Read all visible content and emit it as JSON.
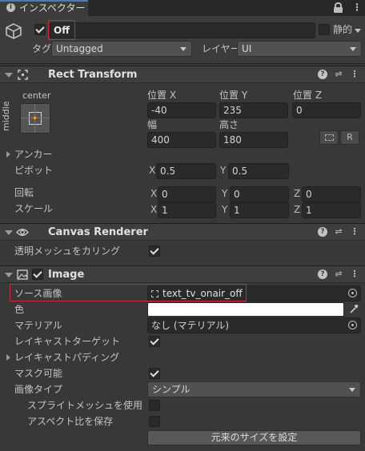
{
  "tab": {
    "title": "インスペクター"
  },
  "object": {
    "name": "Off",
    "static_label": "静的",
    "tag_label": "タグ",
    "tag_value": "Untagged",
    "layer_label": "レイヤー",
    "layer_value": "UI"
  },
  "rect_transform": {
    "title": "Rect Transform",
    "anchor_h": "center",
    "anchor_v": "middle",
    "pos_x_label": "位置 X",
    "pos_y_label": "位置 Y",
    "pos_z_label": "位置 Z",
    "pos_x": "-40",
    "pos_y": "235",
    "pos_z": "0",
    "width_label": "幅",
    "height_label": "高さ",
    "width": "400",
    "height": "180",
    "raw_button": "R",
    "anchors_label": "アンカー",
    "pivot_label": "ピボット",
    "pivot_x": "0.5",
    "pivot_y": "0.5",
    "rotation_label": "回転",
    "rot_x": "0",
    "rot_y": "0",
    "rot_z": "0",
    "scale_label": "スケール",
    "scale_x": "1",
    "scale_y": "1",
    "scale_z": "1",
    "x": "X",
    "y": "Y",
    "z": "Z"
  },
  "canvas_renderer": {
    "title": "Canvas Renderer",
    "cull_label": "透明メッシュをカリング"
  },
  "image": {
    "title": "Image",
    "source_label": "ソース画像",
    "source_value": "text_tv_onair_off",
    "color_label": "色",
    "color_value": "#ffffff",
    "material_label": "マテリアル",
    "material_value": "なし (マテリアル)",
    "raycast_target_label": "レイキャストターゲット",
    "raycast_padding_label": "レイキャストパディング",
    "maskable_label": "マスク可能",
    "image_type_label": "画像タイプ",
    "image_type_value": "シンプル",
    "sprite_mesh_label": "スプライトメッシュを使用",
    "preserve_aspect_label": "アスペクト比を保存",
    "native_size_button": "元来のサイズを設定"
  }
}
